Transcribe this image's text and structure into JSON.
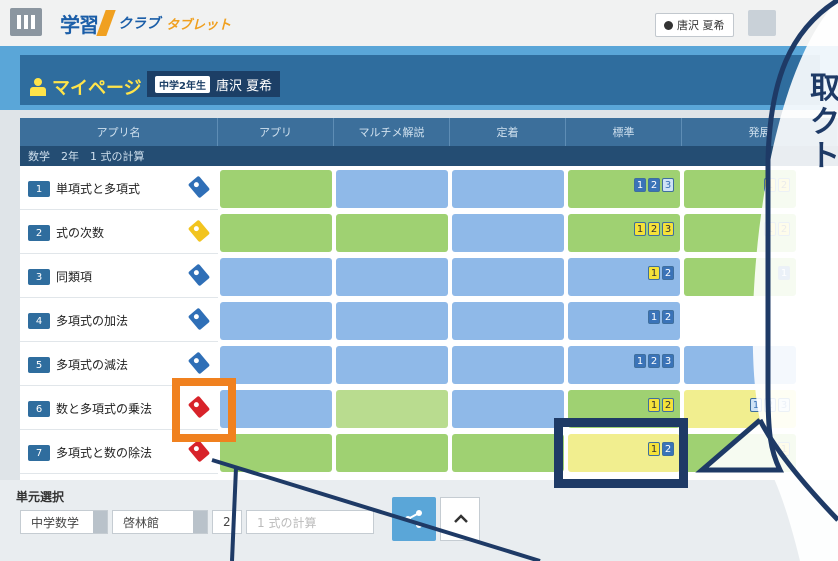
{
  "header": {
    "logo_main": "学習",
    "logo_sub": "クラブ",
    "logo_tab": "タブレット",
    "user_name": "唐沢 夏希"
  },
  "mypage": {
    "title": "マイページ",
    "grade": "中学2年生",
    "student": "唐沢 夏希"
  },
  "table": {
    "headers": [
      "アプリ名",
      "アプリ",
      "マルチメ解説",
      "定着",
      "標準",
      "発展"
    ],
    "subheader": "数学　2年　1 式の計算",
    "rows": [
      {
        "num": "1",
        "label": "単項式と多項式",
        "tag": "blue"
      },
      {
        "num": "2",
        "label": "式の次数",
        "tag": "yellow"
      },
      {
        "num": "3",
        "label": "同類項",
        "tag": "blue"
      },
      {
        "num": "4",
        "label": "多項式の加法",
        "tag": "blue"
      },
      {
        "num": "5",
        "label": "多項式の減法",
        "tag": "blue"
      },
      {
        "num": "6",
        "label": "数と多項式の乗法",
        "tag": "red"
      },
      {
        "num": "7",
        "label": "多項式と数の除法",
        "tag": "red"
      }
    ]
  },
  "bottom": {
    "unit_select_label": "単元選択",
    "subject": "中学数学",
    "textbook": "啓林館",
    "grade": "2",
    "unit": "1 式の計算"
  },
  "callout": {
    "text_lines": [
      "取",
      "ク",
      "ト"
    ]
  },
  "colors": {
    "accent_orange": "#f0811f",
    "accent_navy": "#1e3a66",
    "hero_blue": "#5aa6d8"
  }
}
